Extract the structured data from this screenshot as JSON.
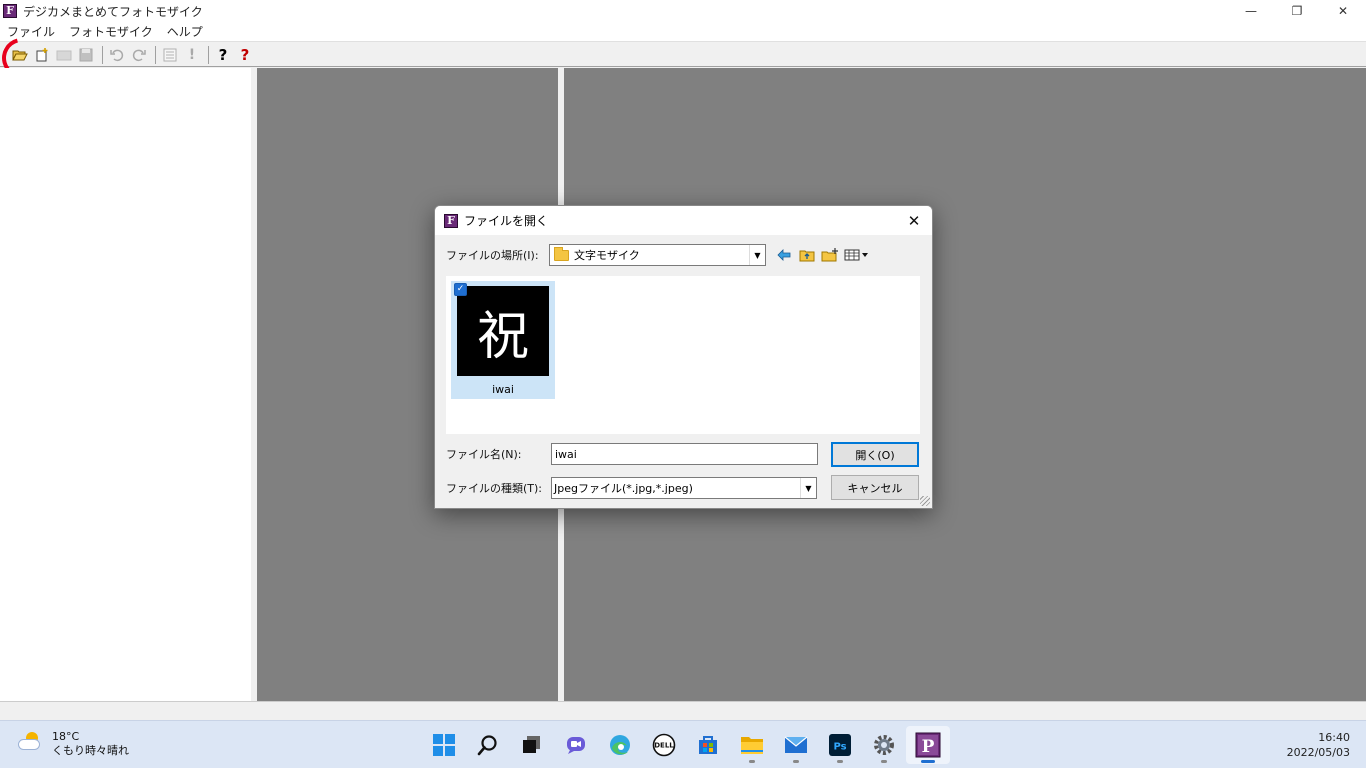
{
  "window": {
    "title": "デジカメまとめてフォトモザイク",
    "app_icon_letter": "F",
    "controls": {
      "minimize": "—",
      "restore": "❐",
      "close": "✕"
    }
  },
  "menu": [
    "ファイル",
    "フォトモザイク",
    "ヘルプ"
  ],
  "toolbar": {
    "buttons": [
      "open-folder-icon",
      "new-file-icon",
      "folder-disabled-icon",
      "save-icon",
      "undo-icon",
      "redo-icon",
      "list-icon",
      "exclamation-icon",
      "help-icon",
      "context-help-icon"
    ],
    "help_glyph": "?",
    "exclamation_glyph": "!"
  },
  "dialog": {
    "title": "ファイルを開く",
    "close_glyph": "✕",
    "look_in_label": "ファイルの場所(I):",
    "look_in_value": "文字モザイク",
    "files": [
      {
        "name": "iwai",
        "thumbnail_char": "祝",
        "selected": true
      }
    ],
    "file_name_label": "ファイル名(N):",
    "file_name_value": "iwai",
    "file_type_label": "ファイルの種類(T):",
    "file_type_value": "Jpegファイル(*.jpg,*.jpeg)",
    "open_button": "開く(O)",
    "cancel_button": "キャンセル",
    "dropdown_arrow": "▼",
    "check_glyph": "✓"
  },
  "taskbar": {
    "weather_temp": "18°C",
    "weather_desc": "くもり時々晴れ",
    "time": "16:40",
    "date": "2022/05/03",
    "apps": [
      "windows-start-icon",
      "search-icon",
      "task-view-icon",
      "chat-icon",
      "edge-icon",
      "dell-icon",
      "store-icon",
      "file-explorer-icon",
      "mail-icon",
      "photoshop-icon",
      "settings-icon",
      "photomosaic-app-icon"
    ],
    "photoshop_label": "Ps",
    "dell_label": "DELL",
    "photomosaic_letter": "P"
  },
  "colors": {
    "accent": "#0078d7",
    "pane_gray": "#808080",
    "highlight_red": "#e8001c",
    "selection": "#cce4f7"
  }
}
